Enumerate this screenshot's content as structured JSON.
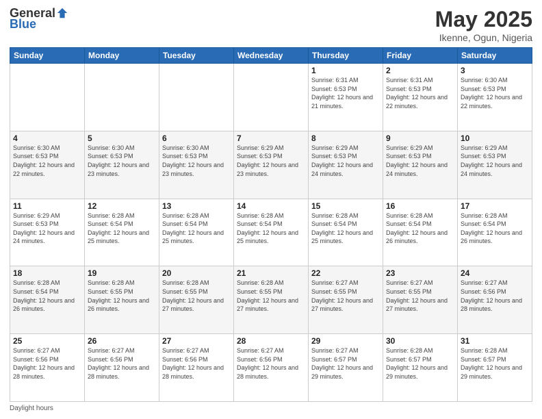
{
  "logo": {
    "text_general": "General",
    "text_blue": "Blue"
  },
  "title": {
    "month_year": "May 2025",
    "location": "Ikenne, Ogun, Nigeria"
  },
  "days_of_week": [
    "Sunday",
    "Monday",
    "Tuesday",
    "Wednesday",
    "Thursday",
    "Friday",
    "Saturday"
  ],
  "weeks": [
    [
      {
        "day": "",
        "sunrise": "",
        "sunset": "",
        "daylight": ""
      },
      {
        "day": "",
        "sunrise": "",
        "sunset": "",
        "daylight": ""
      },
      {
        "day": "",
        "sunrise": "",
        "sunset": "",
        "daylight": ""
      },
      {
        "day": "",
        "sunrise": "",
        "sunset": "",
        "daylight": ""
      },
      {
        "day": "1",
        "sunrise": "6:31 AM",
        "sunset": "6:53 PM",
        "daylight": "12 hours and 21 minutes."
      },
      {
        "day": "2",
        "sunrise": "6:31 AM",
        "sunset": "6:53 PM",
        "daylight": "12 hours and 22 minutes."
      },
      {
        "day": "3",
        "sunrise": "6:30 AM",
        "sunset": "6:53 PM",
        "daylight": "12 hours and 22 minutes."
      }
    ],
    [
      {
        "day": "4",
        "sunrise": "6:30 AM",
        "sunset": "6:53 PM",
        "daylight": "12 hours and 22 minutes."
      },
      {
        "day": "5",
        "sunrise": "6:30 AM",
        "sunset": "6:53 PM",
        "daylight": "12 hours and 23 minutes."
      },
      {
        "day": "6",
        "sunrise": "6:30 AM",
        "sunset": "6:53 PM",
        "daylight": "12 hours and 23 minutes."
      },
      {
        "day": "7",
        "sunrise": "6:29 AM",
        "sunset": "6:53 PM",
        "daylight": "12 hours and 23 minutes."
      },
      {
        "day": "8",
        "sunrise": "6:29 AM",
        "sunset": "6:53 PM",
        "daylight": "12 hours and 24 minutes."
      },
      {
        "day": "9",
        "sunrise": "6:29 AM",
        "sunset": "6:53 PM",
        "daylight": "12 hours and 24 minutes."
      },
      {
        "day": "10",
        "sunrise": "6:29 AM",
        "sunset": "6:53 PM",
        "daylight": "12 hours and 24 minutes."
      }
    ],
    [
      {
        "day": "11",
        "sunrise": "6:29 AM",
        "sunset": "6:53 PM",
        "daylight": "12 hours and 24 minutes."
      },
      {
        "day": "12",
        "sunrise": "6:28 AM",
        "sunset": "6:54 PM",
        "daylight": "12 hours and 25 minutes."
      },
      {
        "day": "13",
        "sunrise": "6:28 AM",
        "sunset": "6:54 PM",
        "daylight": "12 hours and 25 minutes."
      },
      {
        "day": "14",
        "sunrise": "6:28 AM",
        "sunset": "6:54 PM",
        "daylight": "12 hours and 25 minutes."
      },
      {
        "day": "15",
        "sunrise": "6:28 AM",
        "sunset": "6:54 PM",
        "daylight": "12 hours and 25 minutes."
      },
      {
        "day": "16",
        "sunrise": "6:28 AM",
        "sunset": "6:54 PM",
        "daylight": "12 hours and 26 minutes."
      },
      {
        "day": "17",
        "sunrise": "6:28 AM",
        "sunset": "6:54 PM",
        "daylight": "12 hours and 26 minutes."
      }
    ],
    [
      {
        "day": "18",
        "sunrise": "6:28 AM",
        "sunset": "6:54 PM",
        "daylight": "12 hours and 26 minutes."
      },
      {
        "day": "19",
        "sunrise": "6:28 AM",
        "sunset": "6:55 PM",
        "daylight": "12 hours and 26 minutes."
      },
      {
        "day": "20",
        "sunrise": "6:28 AM",
        "sunset": "6:55 PM",
        "daylight": "12 hours and 27 minutes."
      },
      {
        "day": "21",
        "sunrise": "6:28 AM",
        "sunset": "6:55 PM",
        "daylight": "12 hours and 27 minutes."
      },
      {
        "day": "22",
        "sunrise": "6:27 AM",
        "sunset": "6:55 PM",
        "daylight": "12 hours and 27 minutes."
      },
      {
        "day": "23",
        "sunrise": "6:27 AM",
        "sunset": "6:55 PM",
        "daylight": "12 hours and 27 minutes."
      },
      {
        "day": "24",
        "sunrise": "6:27 AM",
        "sunset": "6:56 PM",
        "daylight": "12 hours and 28 minutes."
      }
    ],
    [
      {
        "day": "25",
        "sunrise": "6:27 AM",
        "sunset": "6:56 PM",
        "daylight": "12 hours and 28 minutes."
      },
      {
        "day": "26",
        "sunrise": "6:27 AM",
        "sunset": "6:56 PM",
        "daylight": "12 hours and 28 minutes."
      },
      {
        "day": "27",
        "sunrise": "6:27 AM",
        "sunset": "6:56 PM",
        "daylight": "12 hours and 28 minutes."
      },
      {
        "day": "28",
        "sunrise": "6:27 AM",
        "sunset": "6:56 PM",
        "daylight": "12 hours and 28 minutes."
      },
      {
        "day": "29",
        "sunrise": "6:27 AM",
        "sunset": "6:57 PM",
        "daylight": "12 hours and 29 minutes."
      },
      {
        "day": "30",
        "sunrise": "6:28 AM",
        "sunset": "6:57 PM",
        "daylight": "12 hours and 29 minutes."
      },
      {
        "day": "31",
        "sunrise": "6:28 AM",
        "sunset": "6:57 PM",
        "daylight": "12 hours and 29 minutes."
      }
    ]
  ],
  "footer": {
    "daylight_label": "Daylight hours"
  }
}
